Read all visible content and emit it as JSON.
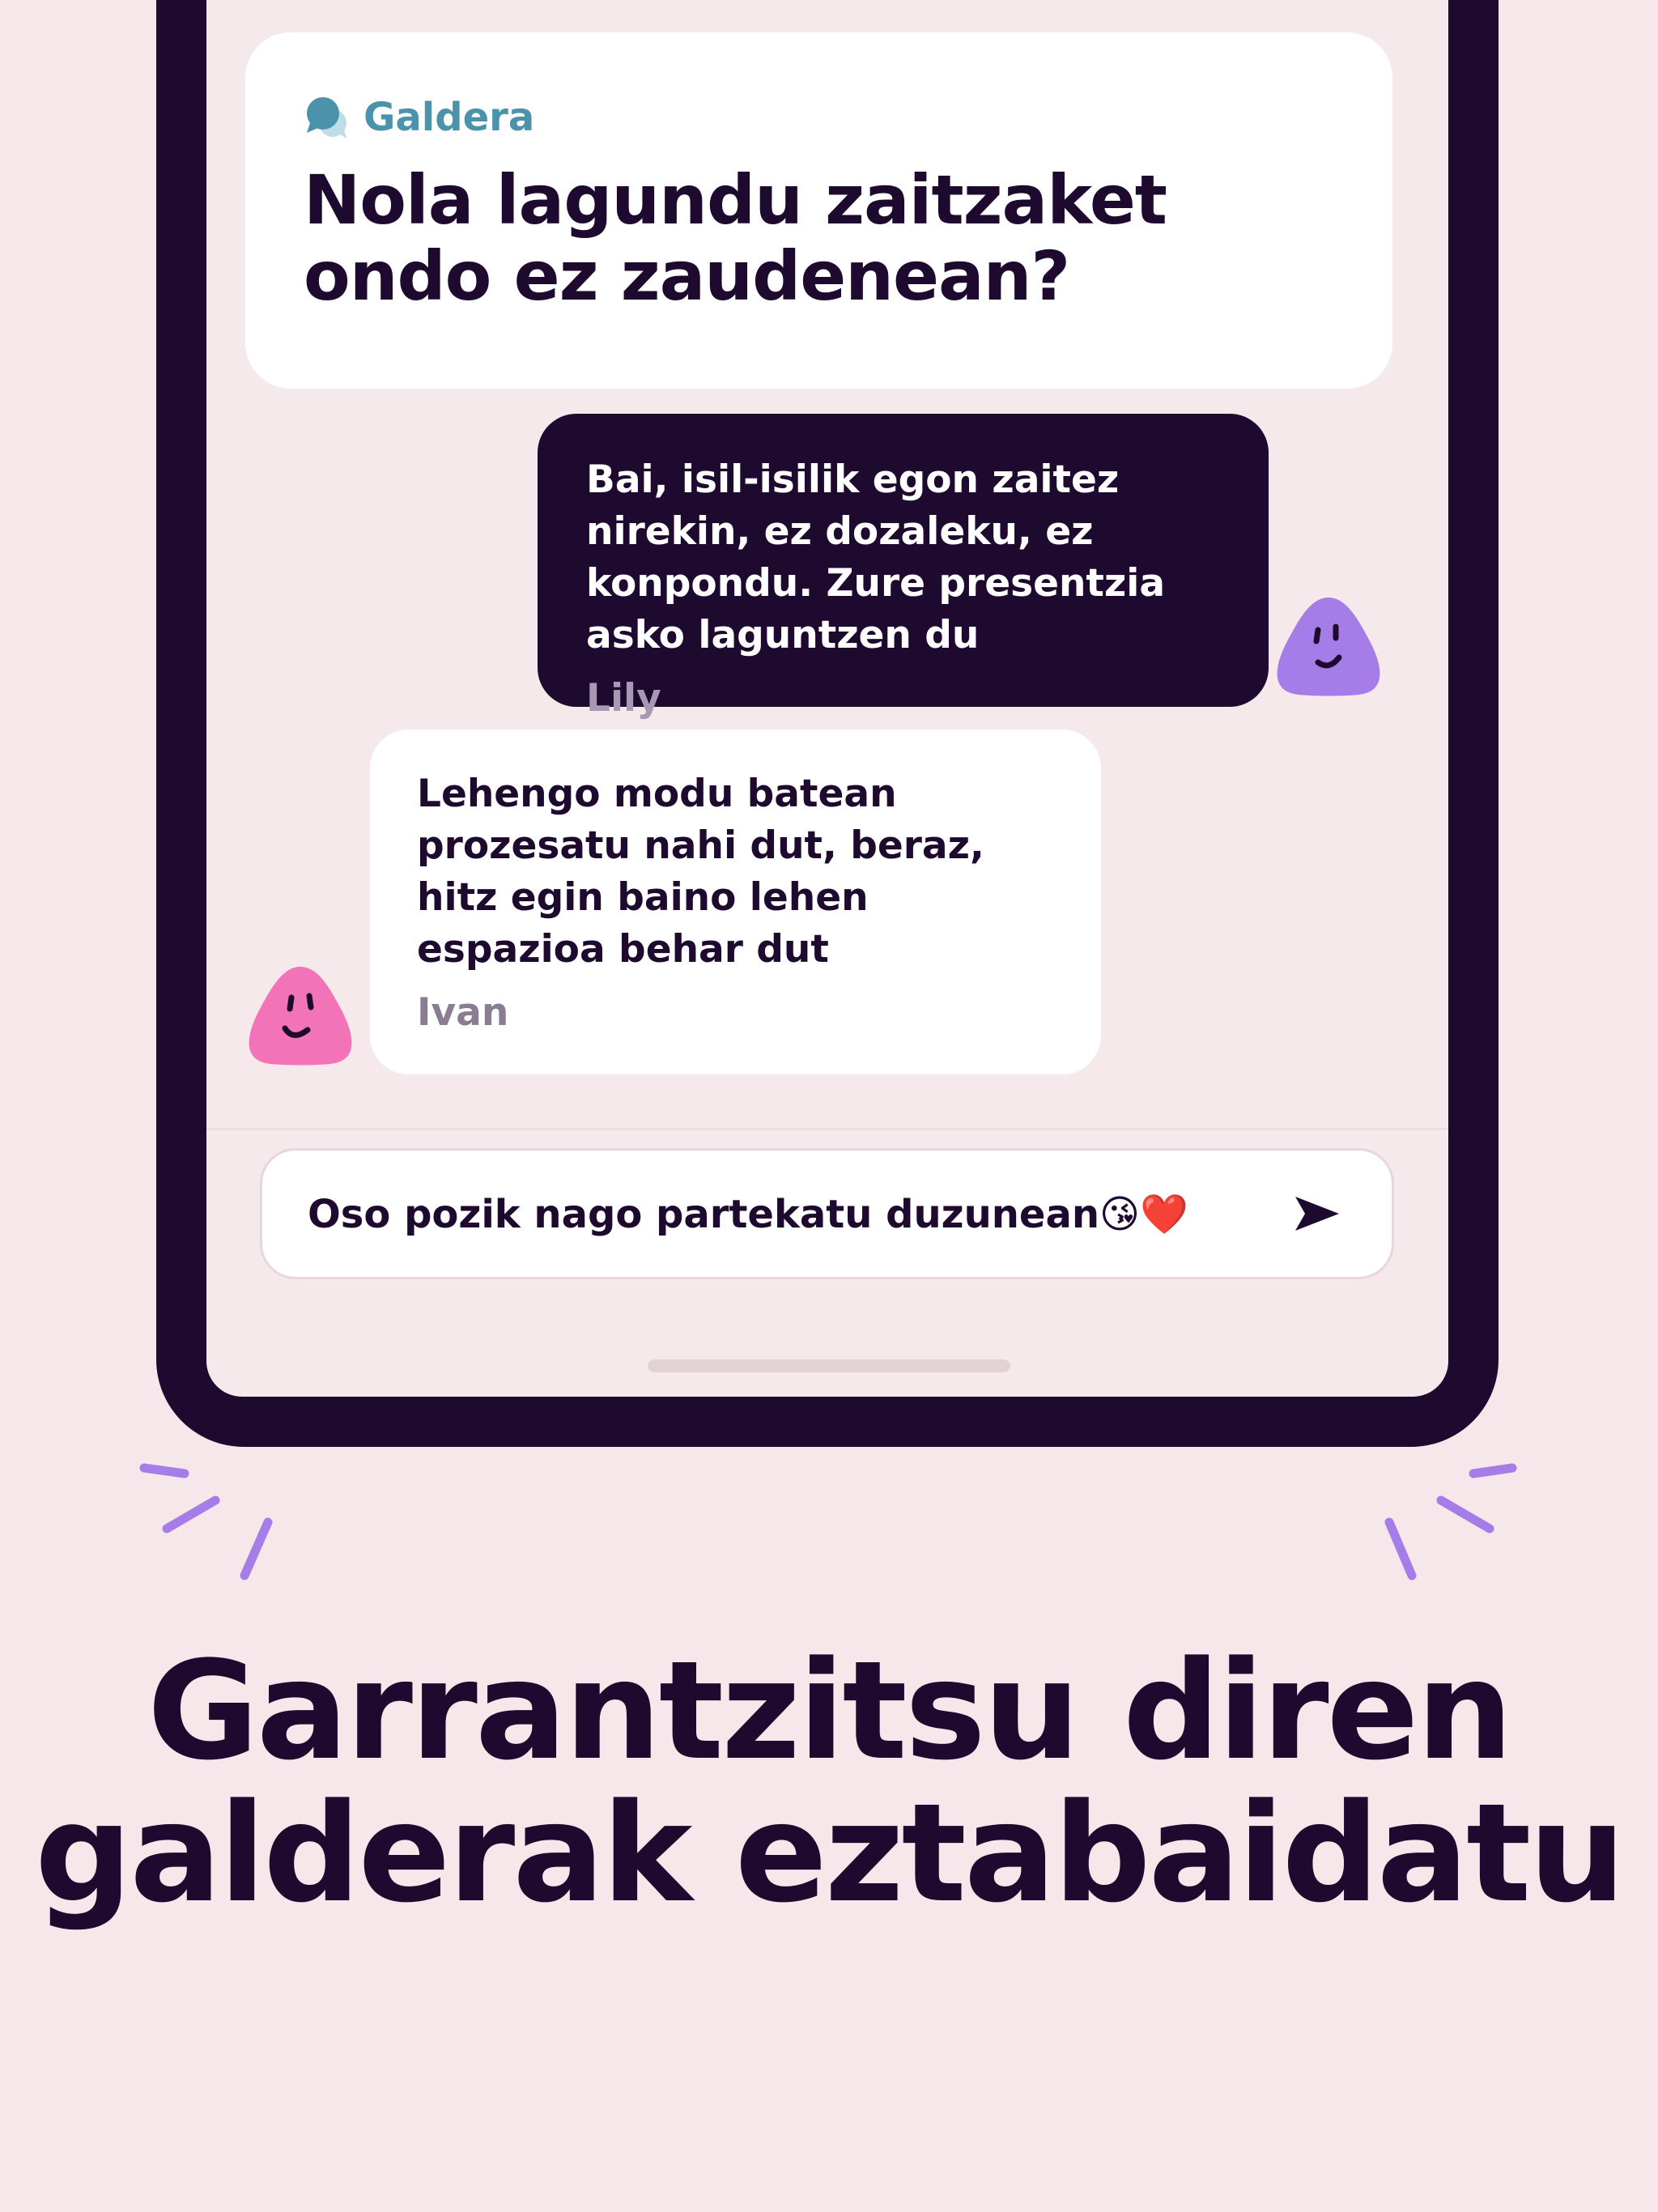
{
  "question": {
    "tag_label": "Galdera",
    "tag_icon": "speech-bubbles-icon",
    "text": "Nola lagundu zaitzaket ondo ez zaudenean?"
  },
  "messages": [
    {
      "text": "Bai, isil-isilik egon zaitez nirekin, ez dozaleku, ez konpondu. Zure presentzia asko laguntzen du",
      "author": "Lily",
      "avatar_color": "#a67ce8"
    },
    {
      "text": "Lehengo modu batean prozesatu nahi dut, beraz, hitz egin baino lehen espazioa behar dut",
      "author": "Ivan",
      "avatar_color": "#f273b8"
    }
  ],
  "composer": {
    "value": "Oso pozik nago partekatu duzunean😘❤️",
    "send_icon": "send-arrow-icon"
  },
  "headline": "Garrantzitsu diren galderak eztabaidatu",
  "colors": {
    "background": "#f5e7ea",
    "ink": "#1e0a2e",
    "accent_blue": "#4b93ab",
    "accent_purple": "#a67ce8",
    "accent_pink": "#f273b8"
  }
}
